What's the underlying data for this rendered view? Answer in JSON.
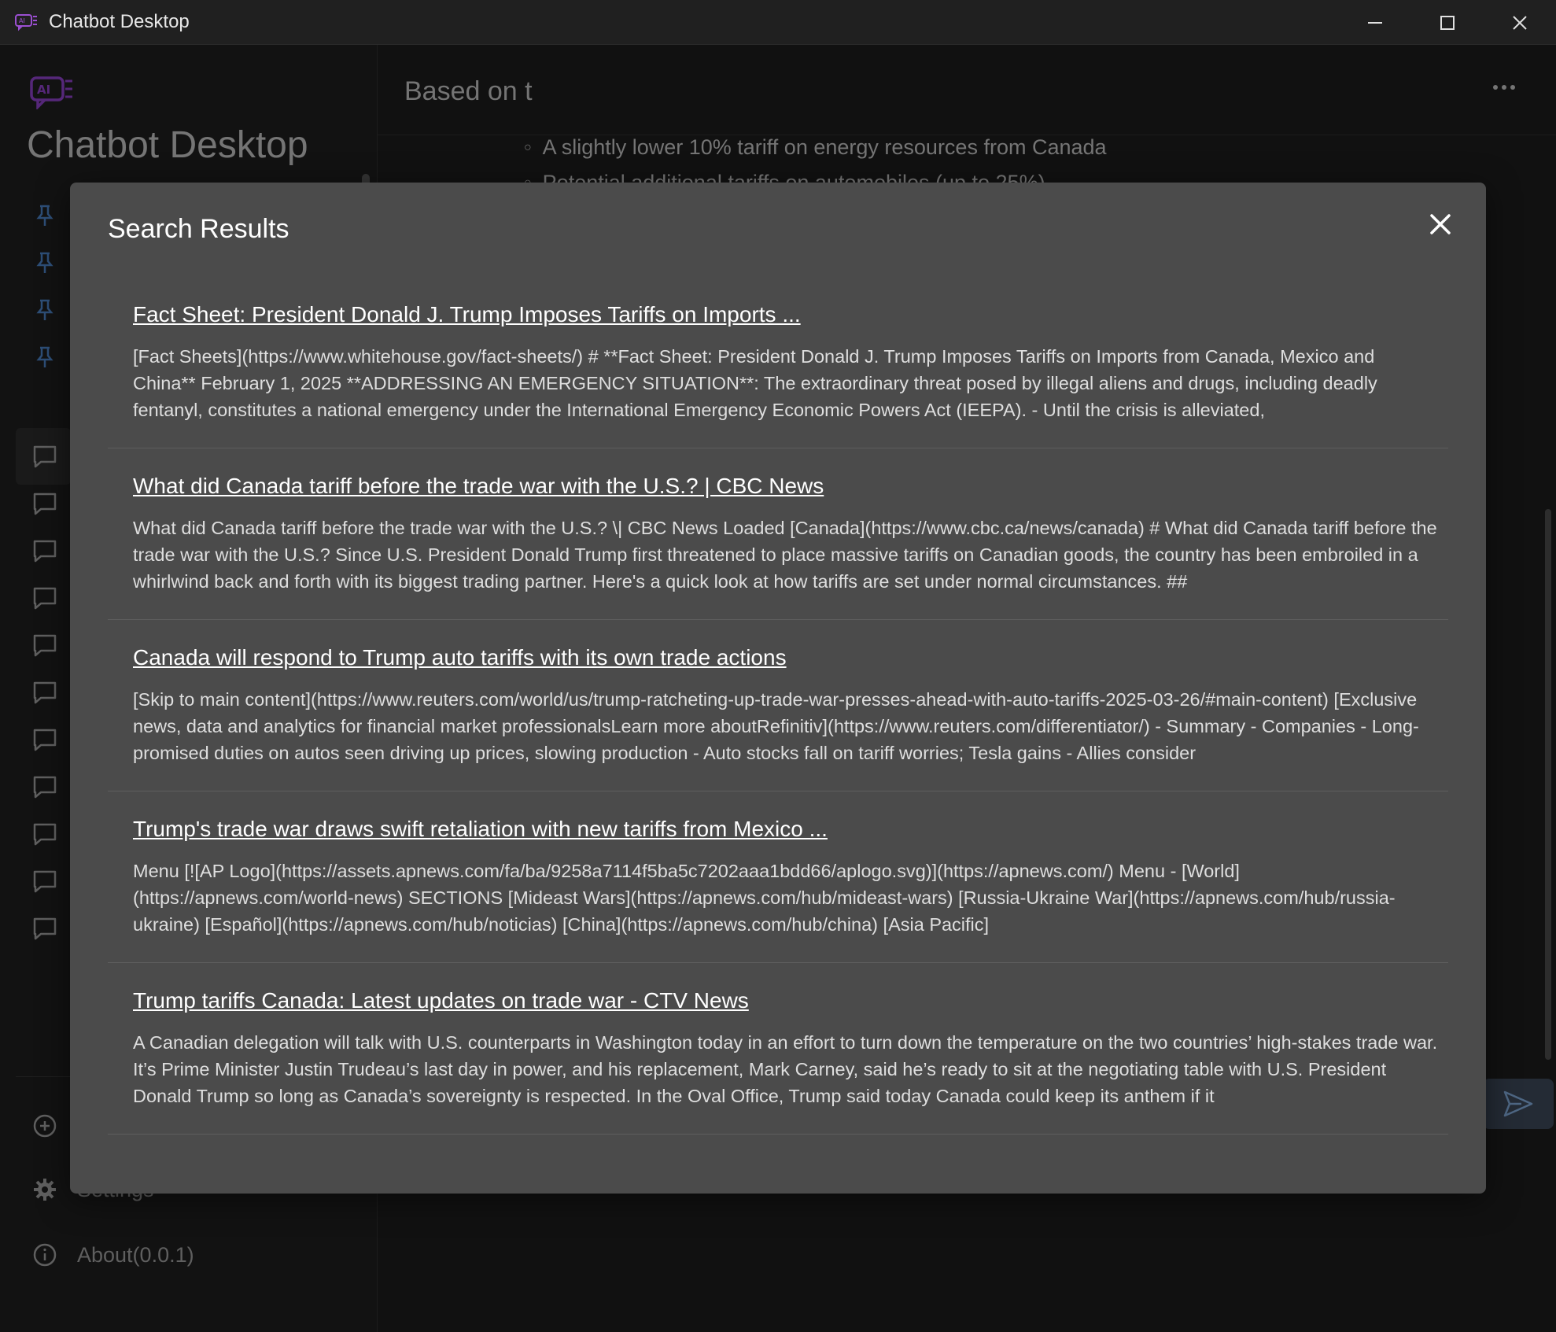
{
  "window": {
    "title": "Chatbot Desktop"
  },
  "sidebar": {
    "brand": "Chatbot Desktop",
    "pinned_count": 4,
    "chat_count": 11,
    "footer": {
      "settings_label": "Settings",
      "about_label": "About(0.0.1)"
    }
  },
  "chat": {
    "title": "Based on t",
    "bullets": [
      "A slightly lower 10% tariff on energy resources from Canada",
      "Potential additional tariffs on automobiles (up to 25%)"
    ]
  },
  "modal": {
    "title": "Search Results",
    "results": [
      {
        "title": "Fact Sheet: President Donald J. Trump Imposes Tariffs on Imports ...",
        "snippet": "[Fact Sheets](https://www.whitehouse.gov/fact-sheets/) # **Fact Sheet: President Donald J. Trump Imposes Tariffs on Imports from Canada, Mexico and China** February 1, 2025 **ADDRESSING AN EMERGENCY SITUATION**: The extraordinary threat posed by illegal aliens and drugs, including deadly fentanyl, constitutes a national emergency under the International Emergency Economic Powers Act (IEEPA). - Until the crisis is alleviated,"
      },
      {
        "title": "What did Canada tariff before the trade war with the U.S.? | CBC News",
        "snippet": "What did Canada tariff before the trade war with the U.S.? \\| CBC News Loaded [Canada](https://www.cbc.ca/news/canada) # What did Canada tariff before the trade war with the U.S.? Since U.S. President Donald Trump first threatened to place massive tariffs on Canadian goods, the country has been embroiled in a whirlwind back and forth with its biggest trading partner. Here's a quick look at how tariffs are set under normal circumstances. ##"
      },
      {
        "title": "Canada will respond to Trump auto tariffs with its own trade actions",
        "snippet": "[Skip to main content](https://www.reuters.com/world/us/trump-ratcheting-up-trade-war-presses-ahead-with-auto-tariffs-2025-03-26/#main-content) [Exclusive news, data and analytics for financial market professionalsLearn more aboutRefinitiv](https://www.reuters.com/differentiator/) - Summary - Companies - Long-promised duties on autos seen driving up prices, slowing production - Auto stocks fall on tariff worries; Tesla gains - Allies consider"
      },
      {
        "title": "Trump's trade war draws swift retaliation with new tariffs from Mexico ...",
        "snippet": "Menu [![AP Logo](https://assets.apnews.com/fa/ba/9258a7114f5ba5c7202aaa1bdd66/aplogo.svg)](https://apnews.com/) Menu - [World](https://apnews.com/world-news) SECTIONS [Mideast Wars](https://apnews.com/hub/mideast-wars) [Russia-Ukraine War](https://apnews.com/hub/russia-ukraine) [Español](https://apnews.com/hub/noticias) [China](https://apnews.com/hub/china) [Asia Pacific]"
      },
      {
        "title": "Trump tariffs Canada: Latest updates on trade war - CTV News",
        "snippet": "A Canadian delegation will talk with U.S. counterparts in Washington today in an effort to turn down the temperature on the two countries’ high-stakes trade war. It’s Prime Minister Justin Trudeau’s last day in power, and his replacement, Mark Carney, said he’s ready to sit at the negotiating table with U.S. President Donald Trump so long as Canada’s sovereignty is respected. In the Oval Office, Trump said today Canada could keep its anthem if it"
      }
    ]
  },
  "colors": {
    "accent_brand": "#8a3fc4",
    "pin_blue": "#4a7fc0",
    "modal_bg": "#4b4b4b"
  }
}
